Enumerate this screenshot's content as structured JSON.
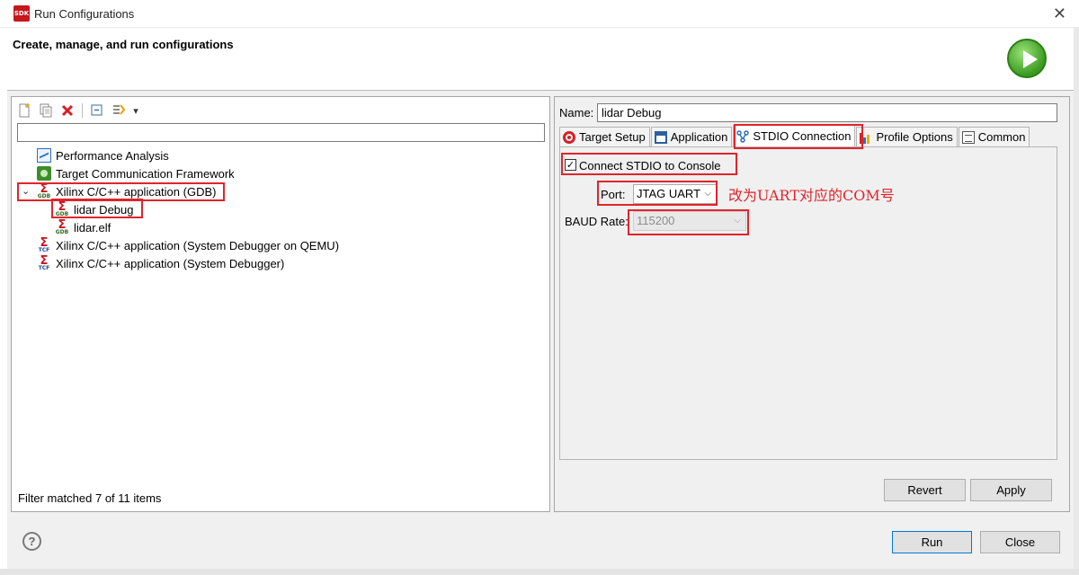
{
  "window": {
    "title": "Run Configurations",
    "app_icon_text": "SDK"
  },
  "header": {
    "title": "Create, manage, and run configurations"
  },
  "toolbar": {
    "icons": [
      "new-config-icon",
      "duplicate-icon",
      "delete-icon",
      "collapse-all-icon",
      "filter-icon",
      "dropdown-icon"
    ],
    "dropdown_glyph": "▾"
  },
  "filter": {
    "value": "",
    "placeholder": ""
  },
  "tree": {
    "items": [
      {
        "label": "Performance Analysis",
        "icon": "performance-icon"
      },
      {
        "label": "Target Communication Framework",
        "icon": "tcf-icon"
      },
      {
        "label": "Xilinx C/C++ application (GDB)",
        "icon": "xilinx-gdb-icon",
        "expanded": true
      },
      {
        "label": "lidar Debug",
        "icon": "xilinx-gdb-icon",
        "selected": true
      },
      {
        "label": "lidar.elf",
        "icon": "xilinx-gdb-icon"
      },
      {
        "label": "Xilinx C/C++ application (System Debugger on QEMU)",
        "icon": "xilinx-tcf-icon"
      },
      {
        "label": "Xilinx C/C++ application (System Debugger)",
        "icon": "xilinx-tcf-icon"
      }
    ],
    "status": "Filter matched 7 of 11 items"
  },
  "config": {
    "name_label": "Name:",
    "name_value": "lidar Debug",
    "tabs": [
      {
        "label": "Target Setup",
        "icon": "target-icon"
      },
      {
        "label": "Application",
        "icon": "application-icon"
      },
      {
        "label": "STDIO Connection",
        "icon": "stdio-icon",
        "active": true
      },
      {
        "label": "Profile Options",
        "icon": "profile-icon"
      },
      {
        "label": "Common",
        "icon": "common-icon"
      }
    ],
    "stdio": {
      "connect_label": "Connect STDIO to Console",
      "connect_checked": true,
      "port_label": "Port:",
      "port_value": "JTAG UART",
      "baud_label": "BAUD Rate:",
      "baud_value": "115200",
      "annotation": "改为UART对应的COM号"
    },
    "revert_label": "Revert",
    "apply_label": "Apply"
  },
  "footer": {
    "help_glyph": "?",
    "run_label": "Run",
    "close_label": "Close"
  },
  "colors": {
    "annotation_red": "#e1242b",
    "primary_border": "#0078d7",
    "xilinx_red": "#c8161d"
  }
}
